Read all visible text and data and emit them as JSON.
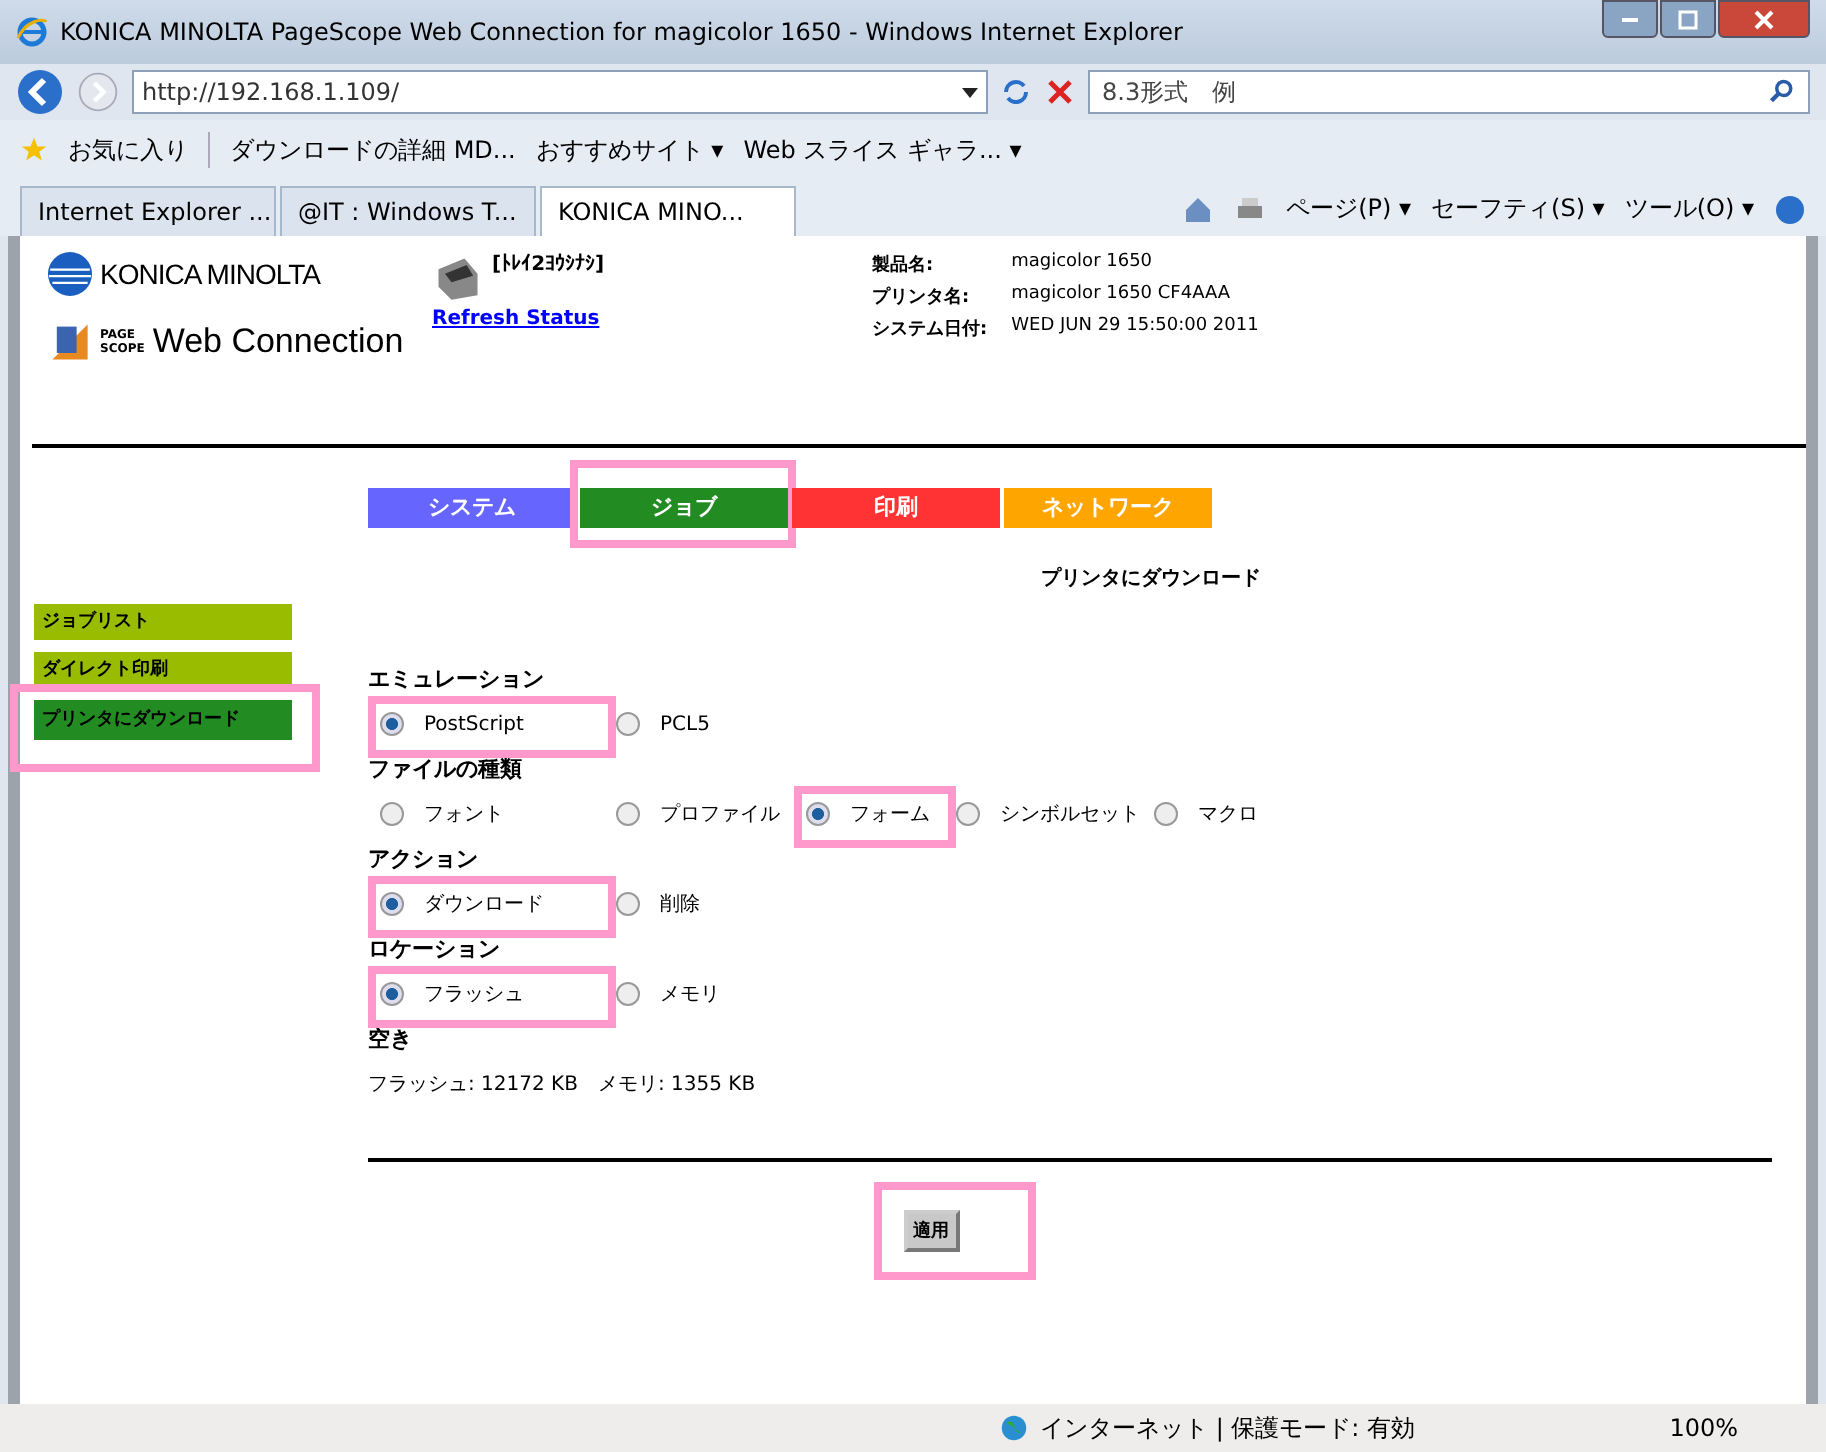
{
  "window": {
    "title": "KONICA MINOLTA PageScope Web Connection for magicolor 1650 - Windows Internet Explorer"
  },
  "address_bar": {
    "url": "http://192.168.1.109/"
  },
  "search": {
    "value": "8.3形式　例"
  },
  "favorites_bar": {
    "favorites_label": "お気に入り",
    "items": [
      "ダウンロードの詳細 MD...",
      "おすすめサイト ▾",
      "Web スライス ギャラ... ▾"
    ]
  },
  "browser_tabs": [
    {
      "label": "Internet Explorer ...",
      "selected": false
    },
    {
      "label": "@IT : Windows T...",
      "selected": false
    },
    {
      "label": "KONICA MINO...",
      "selected": true
    }
  ],
  "command_bar": [
    "ページ(P) ▾",
    "セーフティ(S) ▾",
    "ツール(O) ▾"
  ],
  "header": {
    "brand": "KONICA MINOLTA",
    "page_scope_top": "PAGE",
    "page_scope_bottom": "SCOPE",
    "product": "Web Connection",
    "printer_status": "[ﾄﾚｲ2ﾖｳｼﾅｼ]",
    "refresh_link": "Refresh Status",
    "info": [
      {
        "label": "製品名:",
        "value": "magicolor 1650"
      },
      {
        "label": "プリンタ名:",
        "value": "magicolor 1650 CF4AAA"
      },
      {
        "label": "システム日付:",
        "value": "WED JUN 29 15:50:00 2011"
      }
    ]
  },
  "nav_tabs": [
    {
      "label": "システム",
      "color": "#6666ff",
      "highlighted": false
    },
    {
      "label": "ジョブ",
      "color": "#228b22",
      "highlighted": true
    },
    {
      "label": "印刷",
      "color": "#ff3333",
      "highlighted": false
    },
    {
      "label": "ネットワーク",
      "color": "#ffa500",
      "highlighted": false
    }
  ],
  "page_title": "プリンタにダウンロード",
  "sidebar": {
    "items": [
      {
        "label": "ジョブリスト",
        "selected": false,
        "highlighted": false
      },
      {
        "label": "ダイレクト印刷",
        "selected": false,
        "highlighted": false
      },
      {
        "label": "プリンタにダウンロード",
        "selected": true,
        "highlighted": true
      }
    ]
  },
  "form": [
    {
      "title": "エミュレーション",
      "options": [
        {
          "label": "PostScript",
          "selected": true,
          "highlighted": true
        },
        {
          "label": "PCL5",
          "selected": false,
          "highlighted": false
        }
      ]
    },
    {
      "title": "ファイルの種類",
      "options": [
        {
          "label": "フォント",
          "selected": false,
          "highlighted": false
        },
        {
          "label": "プロファイル",
          "selected": false,
          "highlighted": false
        },
        {
          "label": "フォーム",
          "selected": true,
          "highlighted": true
        },
        {
          "label": "シンボルセット",
          "selected": false,
          "highlighted": false
        },
        {
          "label": "マクロ",
          "selected": false,
          "highlighted": false
        }
      ]
    },
    {
      "title": "アクション",
      "options": [
        {
          "label": "ダウンロード",
          "selected": true,
          "highlighted": true
        },
        {
          "label": "削除",
          "selected": false,
          "highlighted": false
        }
      ]
    },
    {
      "title": "ロケーション",
      "options": [
        {
          "label": "フラッシュ",
          "selected": true,
          "highlighted": true
        },
        {
          "label": "メモリ",
          "selected": false,
          "highlighted": false
        }
      ]
    }
  ],
  "free_space": {
    "title": "空き",
    "text": "フラッシュ: 12172 KB　メモリ: 1355 KB"
  },
  "apply_button": {
    "label": "適用",
    "highlighted": true
  },
  "status_bar": {
    "zone": "インターネット | 保護モード: 有効",
    "zoom": "100%"
  }
}
